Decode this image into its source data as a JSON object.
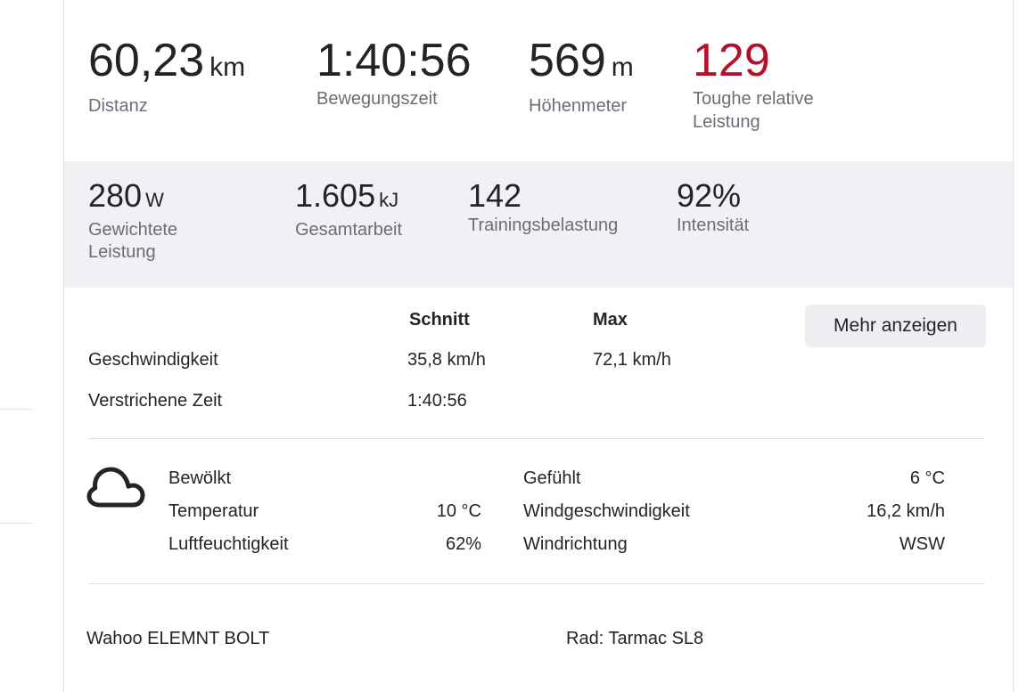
{
  "primary_stats": [
    {
      "value": "60,23",
      "unit": "km",
      "label": "Distanz"
    },
    {
      "value": "1:40:56",
      "unit": "",
      "label": "Bewegungszeit"
    },
    {
      "value": "569",
      "unit": "m",
      "label": "Höhenmeter"
    },
    {
      "value": "129",
      "unit": "",
      "label_line1": "Toughe relative",
      "label_line2": "Leistung",
      "color": "#b5102a"
    }
  ],
  "secondary_stats": [
    {
      "value": "280",
      "unit": "W",
      "label_line1": "Gewichtete",
      "label_line2": "Leistung"
    },
    {
      "value": "1.605",
      "unit": "kJ",
      "label": "Gesamtarbeit"
    },
    {
      "value": "142",
      "unit": "",
      "label": "Trainingsbelastung"
    },
    {
      "value": "92%",
      "unit": "",
      "label": "Intensität"
    }
  ],
  "speed_table": {
    "headers": {
      "avg": "Schnitt",
      "max": "Max"
    },
    "rows": [
      {
        "label": "Geschwindigkeit",
        "avg": "35,8 km/h",
        "max": "72,1 km/h"
      },
      {
        "label": "Verstrichene Zeit",
        "avg": "1:40:56",
        "max": ""
      }
    ],
    "more_button": "Mehr anzeigen"
  },
  "weather": {
    "icon": "cloud-icon",
    "condition": "Bewölkt",
    "left": [
      {
        "label": "Temperatur",
        "value": "10 °C"
      },
      {
        "label": "Luftfeuchtigkeit",
        "value": "62%"
      }
    ],
    "right": [
      {
        "label": "Gefühlt",
        "value": "6 °C"
      },
      {
        "label": "Windgeschwindigkeit",
        "value": "16,2 km/h"
      },
      {
        "label": "Windrichtung",
        "value": "WSW"
      }
    ]
  },
  "footer": {
    "device": "Wahoo ELEMNT BOLT",
    "bike": "Rad: Tarmac SL8"
  }
}
